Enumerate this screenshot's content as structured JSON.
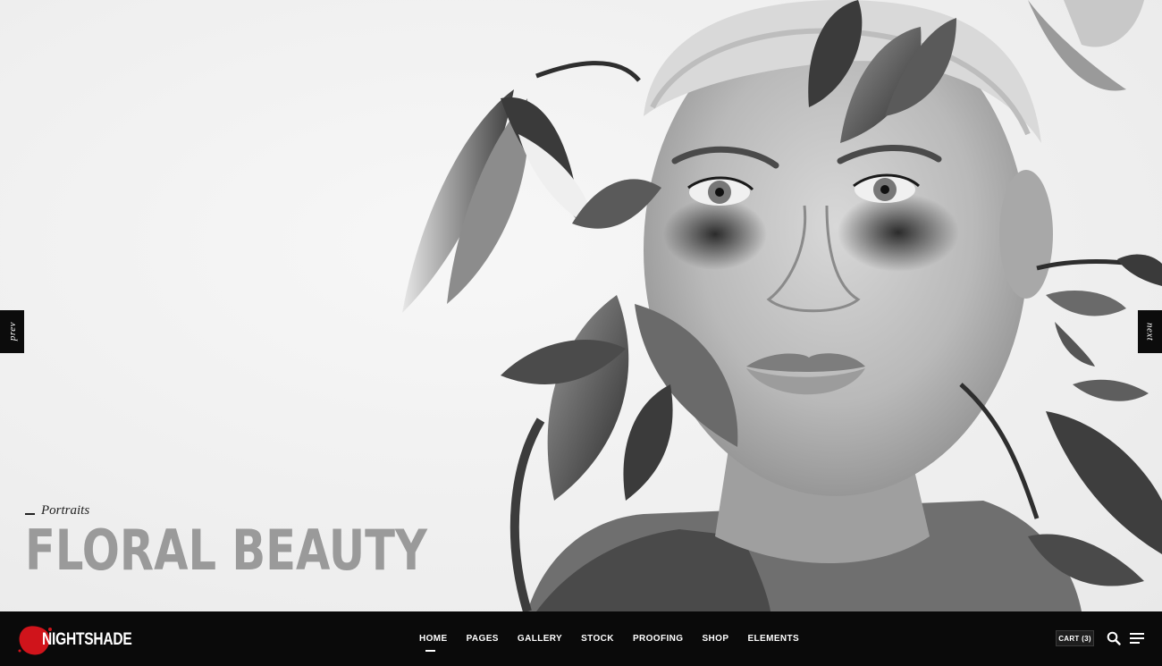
{
  "hero": {
    "category": "Portraits",
    "title": "FLORAL BEAUTY"
  },
  "slider": {
    "prev_label": "prev",
    "next_label": "next"
  },
  "brand": {
    "name": "NIGHTSHADE",
    "accent_color": "#d0141b"
  },
  "nav": {
    "items": [
      {
        "label": "HOME",
        "active": true
      },
      {
        "label": "PAGES"
      },
      {
        "label": "GALLERY"
      },
      {
        "label": "STOCK"
      },
      {
        "label": "PROOFING"
      },
      {
        "label": "SHOP"
      },
      {
        "label": "ELEMENTS"
      }
    ],
    "cart_label": "CART (3)",
    "search_icon": "search-icon",
    "menu_icon": "hamburger-menu-icon"
  }
}
